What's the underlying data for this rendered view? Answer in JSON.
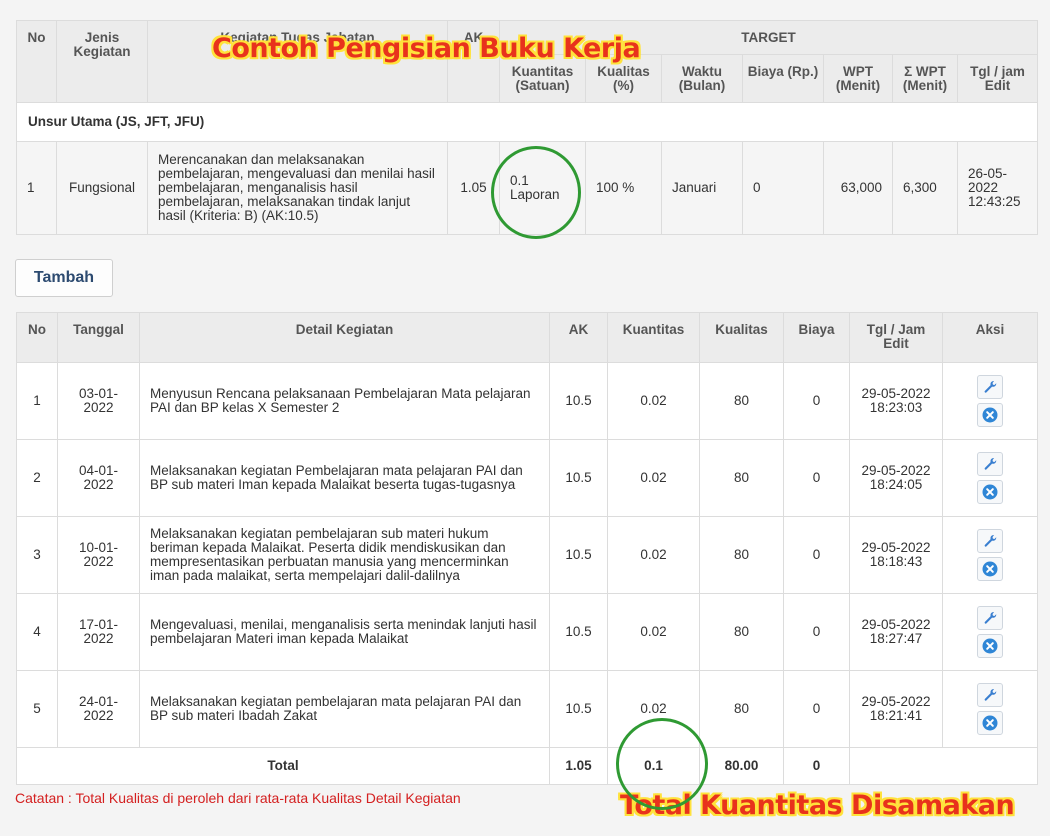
{
  "target": {
    "headers": {
      "no": "No",
      "jenis": "Jenis Kegiatan",
      "kegiatan": "Kegiatan Tugas Jabatan",
      "ak": "AK",
      "target": "TARGET",
      "kuantitas": "Kuantitas (Satuan)",
      "kualitas": "Kualitas (%)",
      "waktu": "Waktu (Bulan)",
      "biaya": "Biaya (Rp.)",
      "wpt": "WPT (Menit)",
      "swpt": "Σ WPT (Menit)",
      "tgl": "Tgl / jam Edit"
    },
    "group_label": "Unsur Utama (JS, JFT, JFU)",
    "row": {
      "no": "1",
      "jenis": "Fungsional",
      "kegiatan": "Merencanakan dan melaksanakan pembelajaran, mengevaluasi dan menilai hasil pembelajaran, menganalisis hasil pembelajaran, melaksanakan tindak lanjut hasil (Kriteria: B) (AK:10.5)",
      "ak": "1.05",
      "kuantitas_value": "0.1",
      "kuantitas_unit": "Laporan",
      "kualitas": "100 %",
      "waktu": "Januari",
      "biaya": "0",
      "wpt": "63,000",
      "swpt": "6,300",
      "tgl_date": "26-05-2022",
      "tgl_time": "12:43:25"
    }
  },
  "tambah_label": "Tambah",
  "detail": {
    "headers": {
      "no": "No",
      "tanggal": "Tanggal",
      "detail": "Detail Kegiatan",
      "ak": "AK",
      "kuantitas": "Kuantitas",
      "kualitas": "Kualitas",
      "biaya": "Biaya",
      "tgl": "Tgl / Jam Edit",
      "aksi": "Aksi"
    },
    "rows": [
      {
        "no": "1",
        "tanggal": "03-01-2022",
        "detail": "Menyusun Rencana pelaksanaan Pembelajaran Mata pelajaran PAI dan BP kelas X Semester 2",
        "ak": "10.5",
        "kuantitas": "0.02",
        "kualitas": "80",
        "biaya": "0",
        "tgl_date": "29-05-2022",
        "tgl_time": "18:23:03"
      },
      {
        "no": "2",
        "tanggal": "04-01-2022",
        "detail": "Melaksanakan kegiatan Pembelajaran mata pelajaran PAI dan BP sub materi Iman kepada Malaikat beserta tugas-tugasnya",
        "ak": "10.5",
        "kuantitas": "0.02",
        "kualitas": "80",
        "biaya": "0",
        "tgl_date": "29-05-2022",
        "tgl_time": "18:24:05"
      },
      {
        "no": "3",
        "tanggal": "10-01-2022",
        "detail": "Melaksanakan kegiatan pembelajaran sub materi hukum beriman kepada Malaikat. Peserta didik mendiskusikan dan mempresentasikan perbuatan manusia yang mencerminkan iman pada malaikat, serta mempelajari dalil-dalilnya",
        "ak": "10.5",
        "kuantitas": "0.02",
        "kualitas": "80",
        "biaya": "0",
        "tgl_date": "29-05-2022",
        "tgl_time": "18:18:43"
      },
      {
        "no": "4",
        "tanggal": "17-01-2022",
        "detail": "Mengevaluasi, menilai, menganalisis serta menindak lanjuti hasil pembelajaran Materi iman kepada Malaikat",
        "ak": "10.5",
        "kuantitas": "0.02",
        "kualitas": "80",
        "biaya": "0",
        "tgl_date": "29-05-2022",
        "tgl_time": "18:27:47"
      },
      {
        "no": "5",
        "tanggal": "24-01-2022",
        "detail": "Melaksanakan kegiatan pembelajaran mata pelajaran PAI dan BP sub materi Ibadah Zakat",
        "ak": "10.5",
        "kuantitas": "0.02",
        "kualitas": "80",
        "biaya": "0",
        "tgl_date": "29-05-2022",
        "tgl_time": "18:21:41"
      }
    ],
    "total": {
      "label": "Total",
      "ak": "1.05",
      "kuantitas": "0.1",
      "kualitas": "80.00",
      "biaya": "0"
    }
  },
  "note": "Catatan : Total Kualitas di peroleh dari rata-rata Kualitas Detail Kegiatan",
  "overlay_top": "Contoh Pengisian Buku Kerja",
  "overlay_bottom": "Total Kuantitas Disamakan",
  "colors": {
    "note": "#d42020",
    "overlay_text": "#e8321c",
    "overlay_outline": "#ffe23b",
    "circle": "#2f9a33",
    "edit_icon": "#3a7fd0",
    "delete_icon": "#2f86d6"
  },
  "icons": {
    "edit": "wrench-icon",
    "delete": "close-circle-icon"
  }
}
